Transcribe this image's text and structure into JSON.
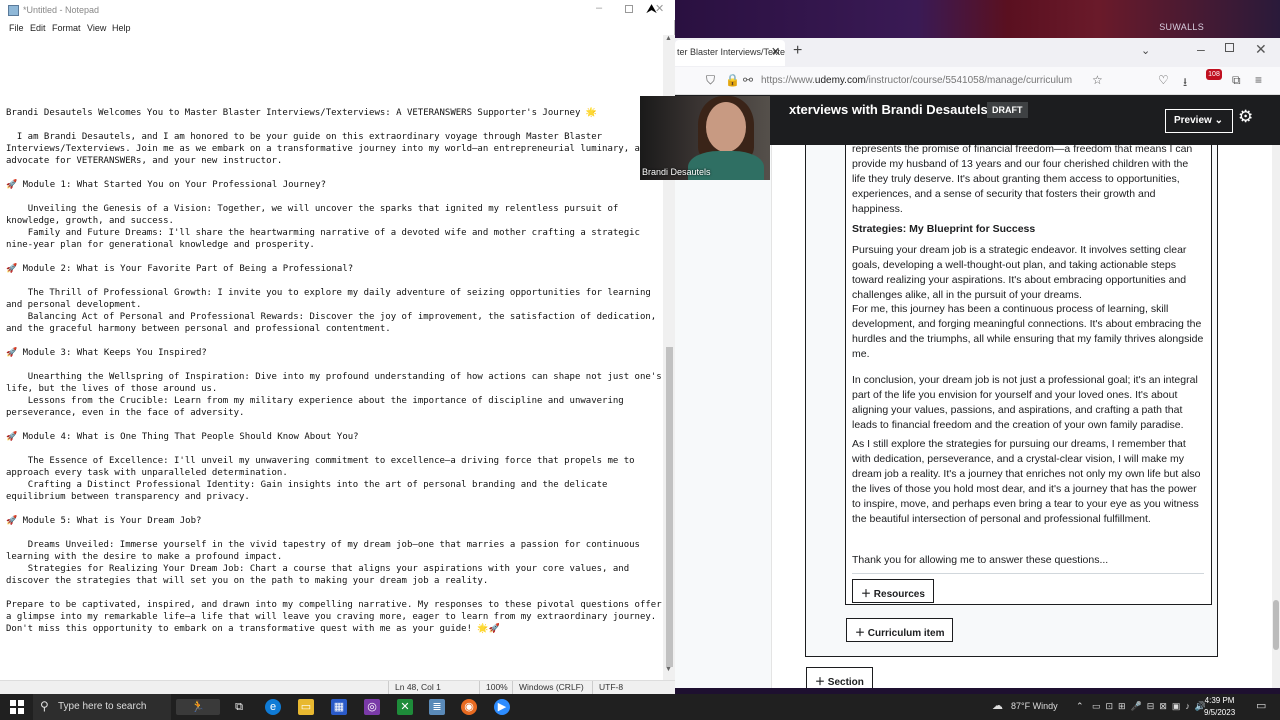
{
  "desktop": {
    "label": "SUWALLS"
  },
  "notepad": {
    "title": "*Untitled - Notepad",
    "menu": [
      "File",
      "Edit",
      "Format",
      "View",
      "Help"
    ],
    "text": "Brandi Desautels Welcomes You to Master Blaster Interviews/Texterviews: A VETERANSWERS Supporter's Journey 🌟\n\n  I am Brandi Desautels, and I am honored to be your guide on this extraordinary voyage through Master Blaster\nInterviews/Texterviews. Join me as we embark on a transformative journey into my world—an entrepreneurial luminary, a\nadvocate for VETERANSWERs, and your new instructor.\n\n🚀 Module 1: What Started You on Your Professional Journey?\n\n    Unveiling the Genesis of a Vision: Together, we will uncover the sparks that ignited my relentless pursuit of\nknowledge, growth, and success.\n    Family and Future Dreams: I'll share the heartwarming narrative of a devoted wife and mother crafting a strategic\nnine-year plan for generational knowledge and prosperity.\n\n🚀 Module 2: What is Your Favorite Part of Being a Professional?\n\n    The Thrill of Professional Growth: I invite you to explore my daily adventure of seizing opportunities for learning\nand personal development.\n    Balancing Act of Personal and Professional Rewards: Discover the joy of improvement, the satisfaction of dedication,\nand the graceful harmony between personal and professional contentment.\n\n🚀 Module 3: What Keeps You Inspired?\n\n    Unearthing the Wellspring of Inspiration: Dive into my profound understanding of how actions can shape not just one's\nlife, but the lives of those around us.\n    Lessons from the Crucible: Learn from my military experience about the importance of discipline and unwavering\nperseverance, even in the face of adversity.\n\n🚀 Module 4: What is One Thing That People Should Know About You?\n\n    The Essence of Excellence: I'll unveil my unwavering commitment to excellence—a driving force that propels me to\napproach every task with unparalleled determination.\n    Crafting a Distinct Professional Identity: Gain insights into the art of personal branding and the delicate\nequilibrium between transparency and privacy.\n\n🚀 Module 5: What is Your Dream Job?\n\n    Dreams Unveiled: Immerse yourself in the vivid tapestry of my dream job—one that marries a passion for continuous\nlearning with the desire to make a profound impact.\n    Strategies for Realizing Your Dream Job: Chart a course that aligns your aspirations with your core values, and\ndiscover the strategies that will set you on the path to making your dream job a reality.\n\nPrepare to be captivated, inspired, and drawn into my compelling narrative. My responses to these pivotal questions offer\na glimpse into my remarkable life—a life that will leave you craving more, eager to learn from my extraordinary journey.\nDon't miss this opportunity to embark on a transformative quest with me as your guide! 🌟🚀",
    "status": {
      "position": "Ln 48, Col 1",
      "zoom": "100%",
      "line_ending": "Windows (CRLF)",
      "encoding": "UTF-8"
    }
  },
  "webcam": {
    "name": "Brandi Desautels"
  },
  "browser": {
    "tab_title": "ter Blaster Interviews/Texte",
    "url_prefix": "https://www.",
    "url_domain": "udemy.com",
    "url_path": "/instructor/course/5541058/manage/curriculum",
    "notification_count": "108",
    "course_title": "xterviews with Brandi Desautels",
    "draft_badge": "DRAFT",
    "preview_label": "Preview",
    "paragraphs": [
      "represents the promise of financial freedom—a freedom that means I can provide my husband of 13 years and our four cherished children with the life they truly deserve. It's about granting them access to opportunities, experiences, and a sense of security that fosters their growth and happiness.",
      "Strategies: My Blueprint for Success",
      "Pursuing your dream job is a strategic endeavor. It involves setting clear goals, developing a well-thought-out plan, and taking actionable steps toward realizing your aspirations. It's about embracing opportunities and challenges alike, all in the pursuit of your dreams.",
      "For me, this journey has been a continuous process of learning, skill development, and forging meaningful connections. It's about embracing the hurdles and the triumphs, all while ensuring that my family thrives alongside me.",
      "In conclusion, your dream job is not just a professional goal; it's an integral part of the life you envision for yourself and your loved ones. It's about aligning your values, passions, and aspirations, and crafting a path that leads to financial freedom and the creation of your own family paradise.",
      "As I still explore the strategies for pursuing our dreams, I remember that with dedication, perseverance, and a crystal-clear vision, I will make my dream job a reality. It's a journey that enriches not only my own life but also the lives of those you hold most dear, and it's a journey that has the power to inspire, move, and perhaps even bring a tear to your eye as you witness the beautiful intersection of personal and professional fulfillment.",
      "Thank you for allowing me to answer these questions..."
    ],
    "resources_label": "Resources",
    "curriculum_item_label": "Curriculum item",
    "section_label": "Section"
  },
  "taskbar": {
    "search_placeholder": "Type here to search",
    "weather": "87°F  Windy",
    "time": "4:39 PM",
    "date": "9/5/2023"
  }
}
